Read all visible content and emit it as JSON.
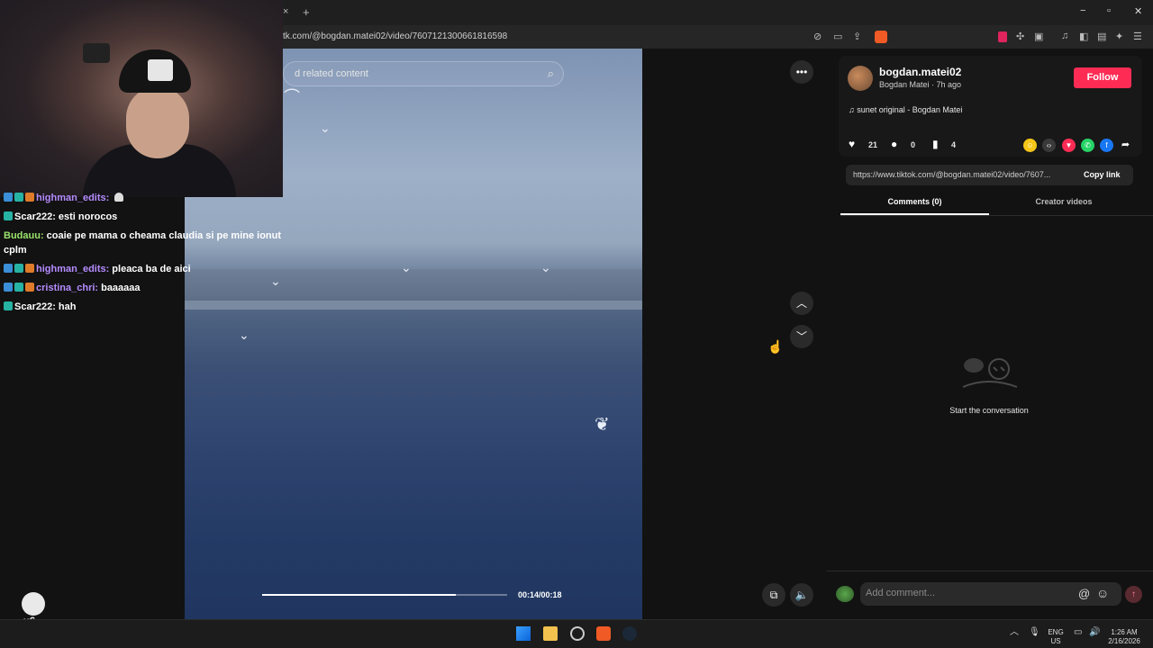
{
  "browser": {
    "url": "tk.com/@bogdan.matei02/video/7607121300661816598",
    "close_tab": "×",
    "new_tab": "+",
    "window_controls": [
      "−",
      "▫",
      "✕"
    ]
  },
  "video": {
    "search_placeholder": "d related content",
    "timecode": "00:14/00:18",
    "progress_fraction": 0.79,
    "more_icon": "more-horizontal-icon",
    "nav_up_icon": "chevron-up-icon",
    "nav_down_icon": "chevron-down-icon"
  },
  "chat": {
    "messages": [
      {
        "user": "highman_edits:",
        "user_color": "#b58cff",
        "text": "",
        "badges": [
          "blue",
          "teal",
          "orange"
        ],
        "emote": "ghost-emote"
      },
      {
        "user": "Scar222:",
        "user_color": "#ffffff",
        "text": "esti norocos",
        "badges": [
          "teal"
        ]
      },
      {
        "user": "Budauu:",
        "user_color": "#9be36b",
        "text": "coaie pe mama o cheama claudia si pe mine ionut cplm",
        "badges": []
      },
      {
        "user": "highman_edits:",
        "user_color": "#b58cff",
        "text": "pleaca ba de aici",
        "badges": [
          "blue",
          "teal",
          "orange"
        ]
      },
      {
        "user": "cristina_chri:",
        "user_color": "#b58cff",
        "text": "baaaaaa",
        "badges": [
          "blue",
          "teal",
          "orange"
        ]
      },
      {
        "user": "Scar222:",
        "user_color": "#ffffff",
        "text": "hah",
        "badges": [
          "teal"
        ]
      }
    ],
    "mascot_count": "x6"
  },
  "author": {
    "username": "bogdan.matei02",
    "display_line": "Bogdan Matei · 7h ago",
    "follow_label": "Follow",
    "music": "sunet original - Bogdan Matei",
    "likes": "21",
    "comments": "0",
    "saves": "4",
    "link": "https://www.tiktok.com/@bogdan.matei02/video/7607...",
    "copy_label": "Copy link",
    "share_targets": [
      "friends-icon",
      "embed-icon",
      "send-icon",
      "whatsapp-icon",
      "facebook-icon",
      "share-arrow-icon"
    ]
  },
  "tabs": {
    "comments": "Comments (0)",
    "creator": "Creator videos"
  },
  "empty_state": "Start the conversation",
  "comment_box": {
    "placeholder": "Add comment...",
    "at_symbol": "@"
  },
  "taskbar": {
    "lang_top": "ENG",
    "lang_bottom": "US",
    "time": "1:26 AM",
    "date": "2/16/2026"
  },
  "colors": {
    "follow": "#fe2c55",
    "accent_chat_purple": "#b58cff",
    "accent_chat_green": "#9be36b"
  }
}
